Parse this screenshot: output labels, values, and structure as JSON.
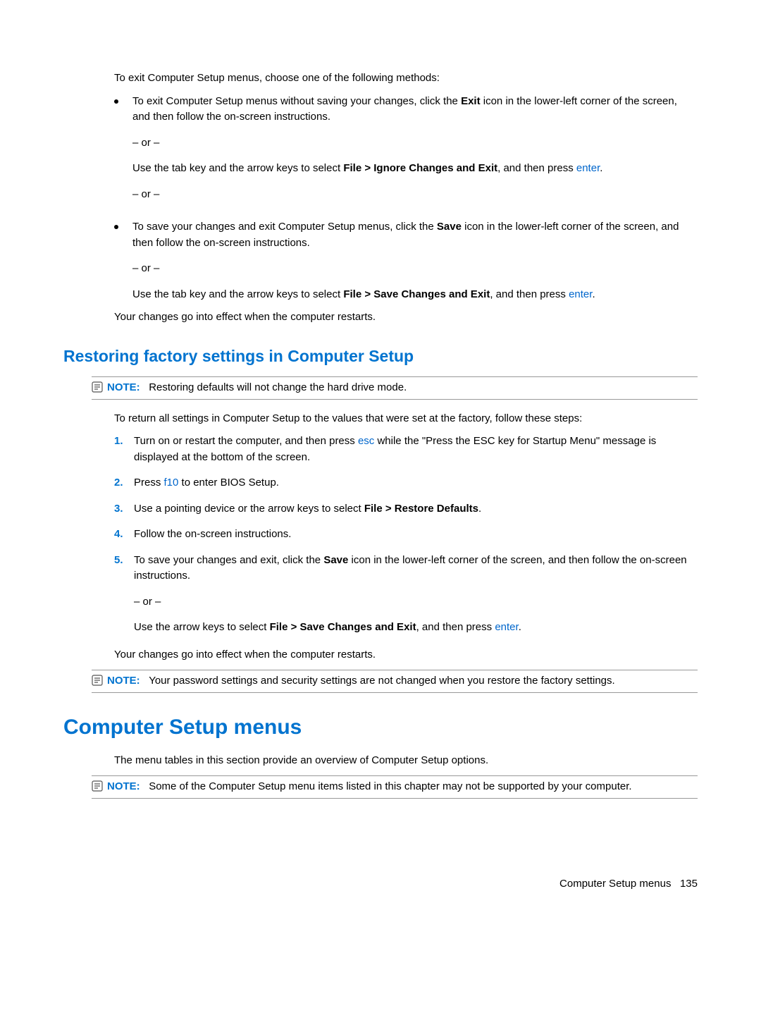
{
  "intro": {
    "p1": "To exit Computer Setup menus, choose one of the following methods:",
    "b1_a": "To exit Computer Setup menus without saving your changes, click the ",
    "b1_bold": "Exit",
    "b1_b": " icon in the lower-left corner of the screen, and then follow the on-screen instructions.",
    "or": "– or –",
    "b1_c": "Use the tab key and the arrow keys to select ",
    "b1_c_bold": "File > Ignore Changes and Exit",
    "b1_c2": ", and then press ",
    "b1_c_key": "enter",
    "b1_c3": ".",
    "b2_a": "To save your changes and exit Computer Setup menus, click the ",
    "b2_bold": "Save",
    "b2_b": " icon in the lower-left corner of the screen, and then follow the on-screen instructions.",
    "b2_c": "Use the tab key and the arrow keys to select ",
    "b2_c_bold": "File > Save Changes and Exit",
    "b2_c2": ", and then press ",
    "b2_c_key": "enter",
    "b2_c3": ".",
    "p_end": "Your changes go into effect when the computer restarts."
  },
  "section1": {
    "title": "Restoring factory settings in Computer Setup",
    "note1_label": "NOTE:",
    "note1": "Restoring defaults will not change the hard drive mode.",
    "p1": "To return all settings in Computer Setup to the values that were set at the factory, follow these steps:",
    "s1_a": "Turn on or restart the computer, and then press ",
    "s1_key": "esc",
    "s1_b": " while the \"Press the ESC key for Startup Menu\" message is displayed at the bottom of the screen.",
    "s2_a": "Press ",
    "s2_key": "f10",
    "s2_b": " to enter BIOS Setup.",
    "s3_a": "Use a pointing device or the arrow keys to select ",
    "s3_bold": "File > Restore Defaults",
    "s3_b": ".",
    "s4": "Follow the on-screen instructions.",
    "s5_a": "To save your changes and exit, click the ",
    "s5_bold": "Save",
    "s5_b": " icon in the lower-left corner of the screen, and then follow the on-screen instructions.",
    "s5_or": "– or –",
    "s5_c": "Use the arrow keys to select ",
    "s5_c_bold": "File > Save Changes and Exit",
    "s5_c2": ", and then press ",
    "s5_c_key": "enter",
    "s5_c3": ".",
    "p_end": "Your changes go into effect when the computer restarts.",
    "note2_label": "NOTE:",
    "note2": "Your password settings and security settings are not changed when you restore the factory settings."
  },
  "section2": {
    "title": "Computer Setup menus",
    "p1": "The menu tables in this section provide an overview of Computer Setup options.",
    "note_label": "NOTE:",
    "note": "Some of the Computer Setup menu items listed in this chapter may not be supported by your computer."
  },
  "footer": {
    "text": "Computer Setup menus",
    "page": "135"
  },
  "steps": {
    "n1": "1.",
    "n2": "2.",
    "n3": "3.",
    "n4": "4.",
    "n5": "5."
  }
}
